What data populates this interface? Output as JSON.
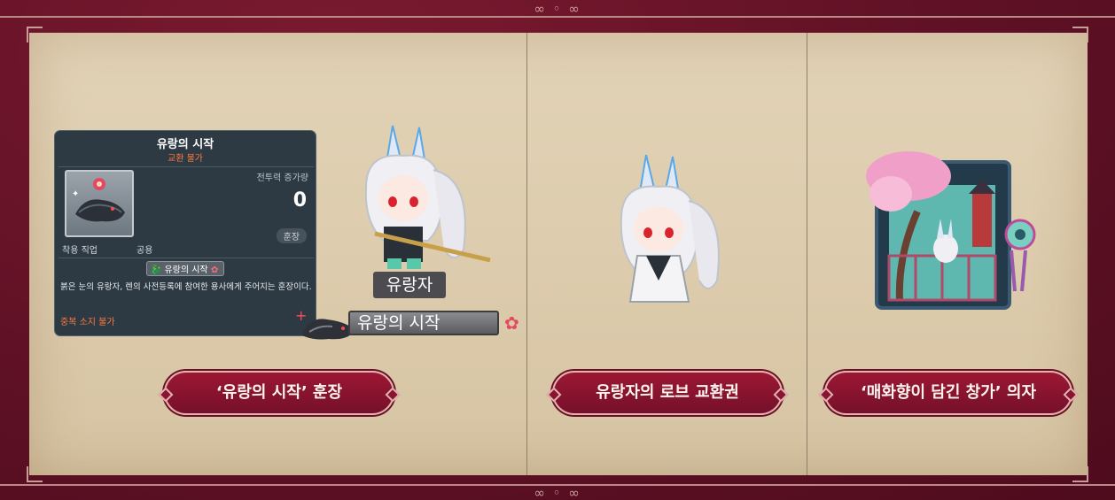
{
  "tooltip": {
    "title": "유랑의 시작",
    "subtitle": "교환 불가",
    "cp_label": "전투력 증가량",
    "cp_value": "0",
    "category": "훈장",
    "job_label": "착용 직업",
    "job_value": "공용",
    "medal_name": "유랑의 시작",
    "description": "붉은 눈의 유랑자, 렌의 사전등록에 참여한 용사에게 주어지는 훈장이다.",
    "warning": "중복 소지 불가"
  },
  "character": {
    "name_tag": "유랑자",
    "medal_tag": "유랑의 시작"
  },
  "rewards": [
    {
      "label": "‘유랑의 시작’ 훈장"
    },
    {
      "label": "유랑자의 로브 교환권"
    },
    {
      "label": "‘매화향이 담긴 창가’ 의자"
    }
  ],
  "colors": {
    "frame": "#6a1428",
    "panel": "#dfcdb0",
    "banner": "#8c1430",
    "tooltip_bg": "#2d3a44",
    "warning_orange": "#ff7a3c"
  },
  "icons": [
    "ornament-icon",
    "medal-icon",
    "dragon-icon",
    "flower-icon",
    "sparkle-icon"
  ]
}
